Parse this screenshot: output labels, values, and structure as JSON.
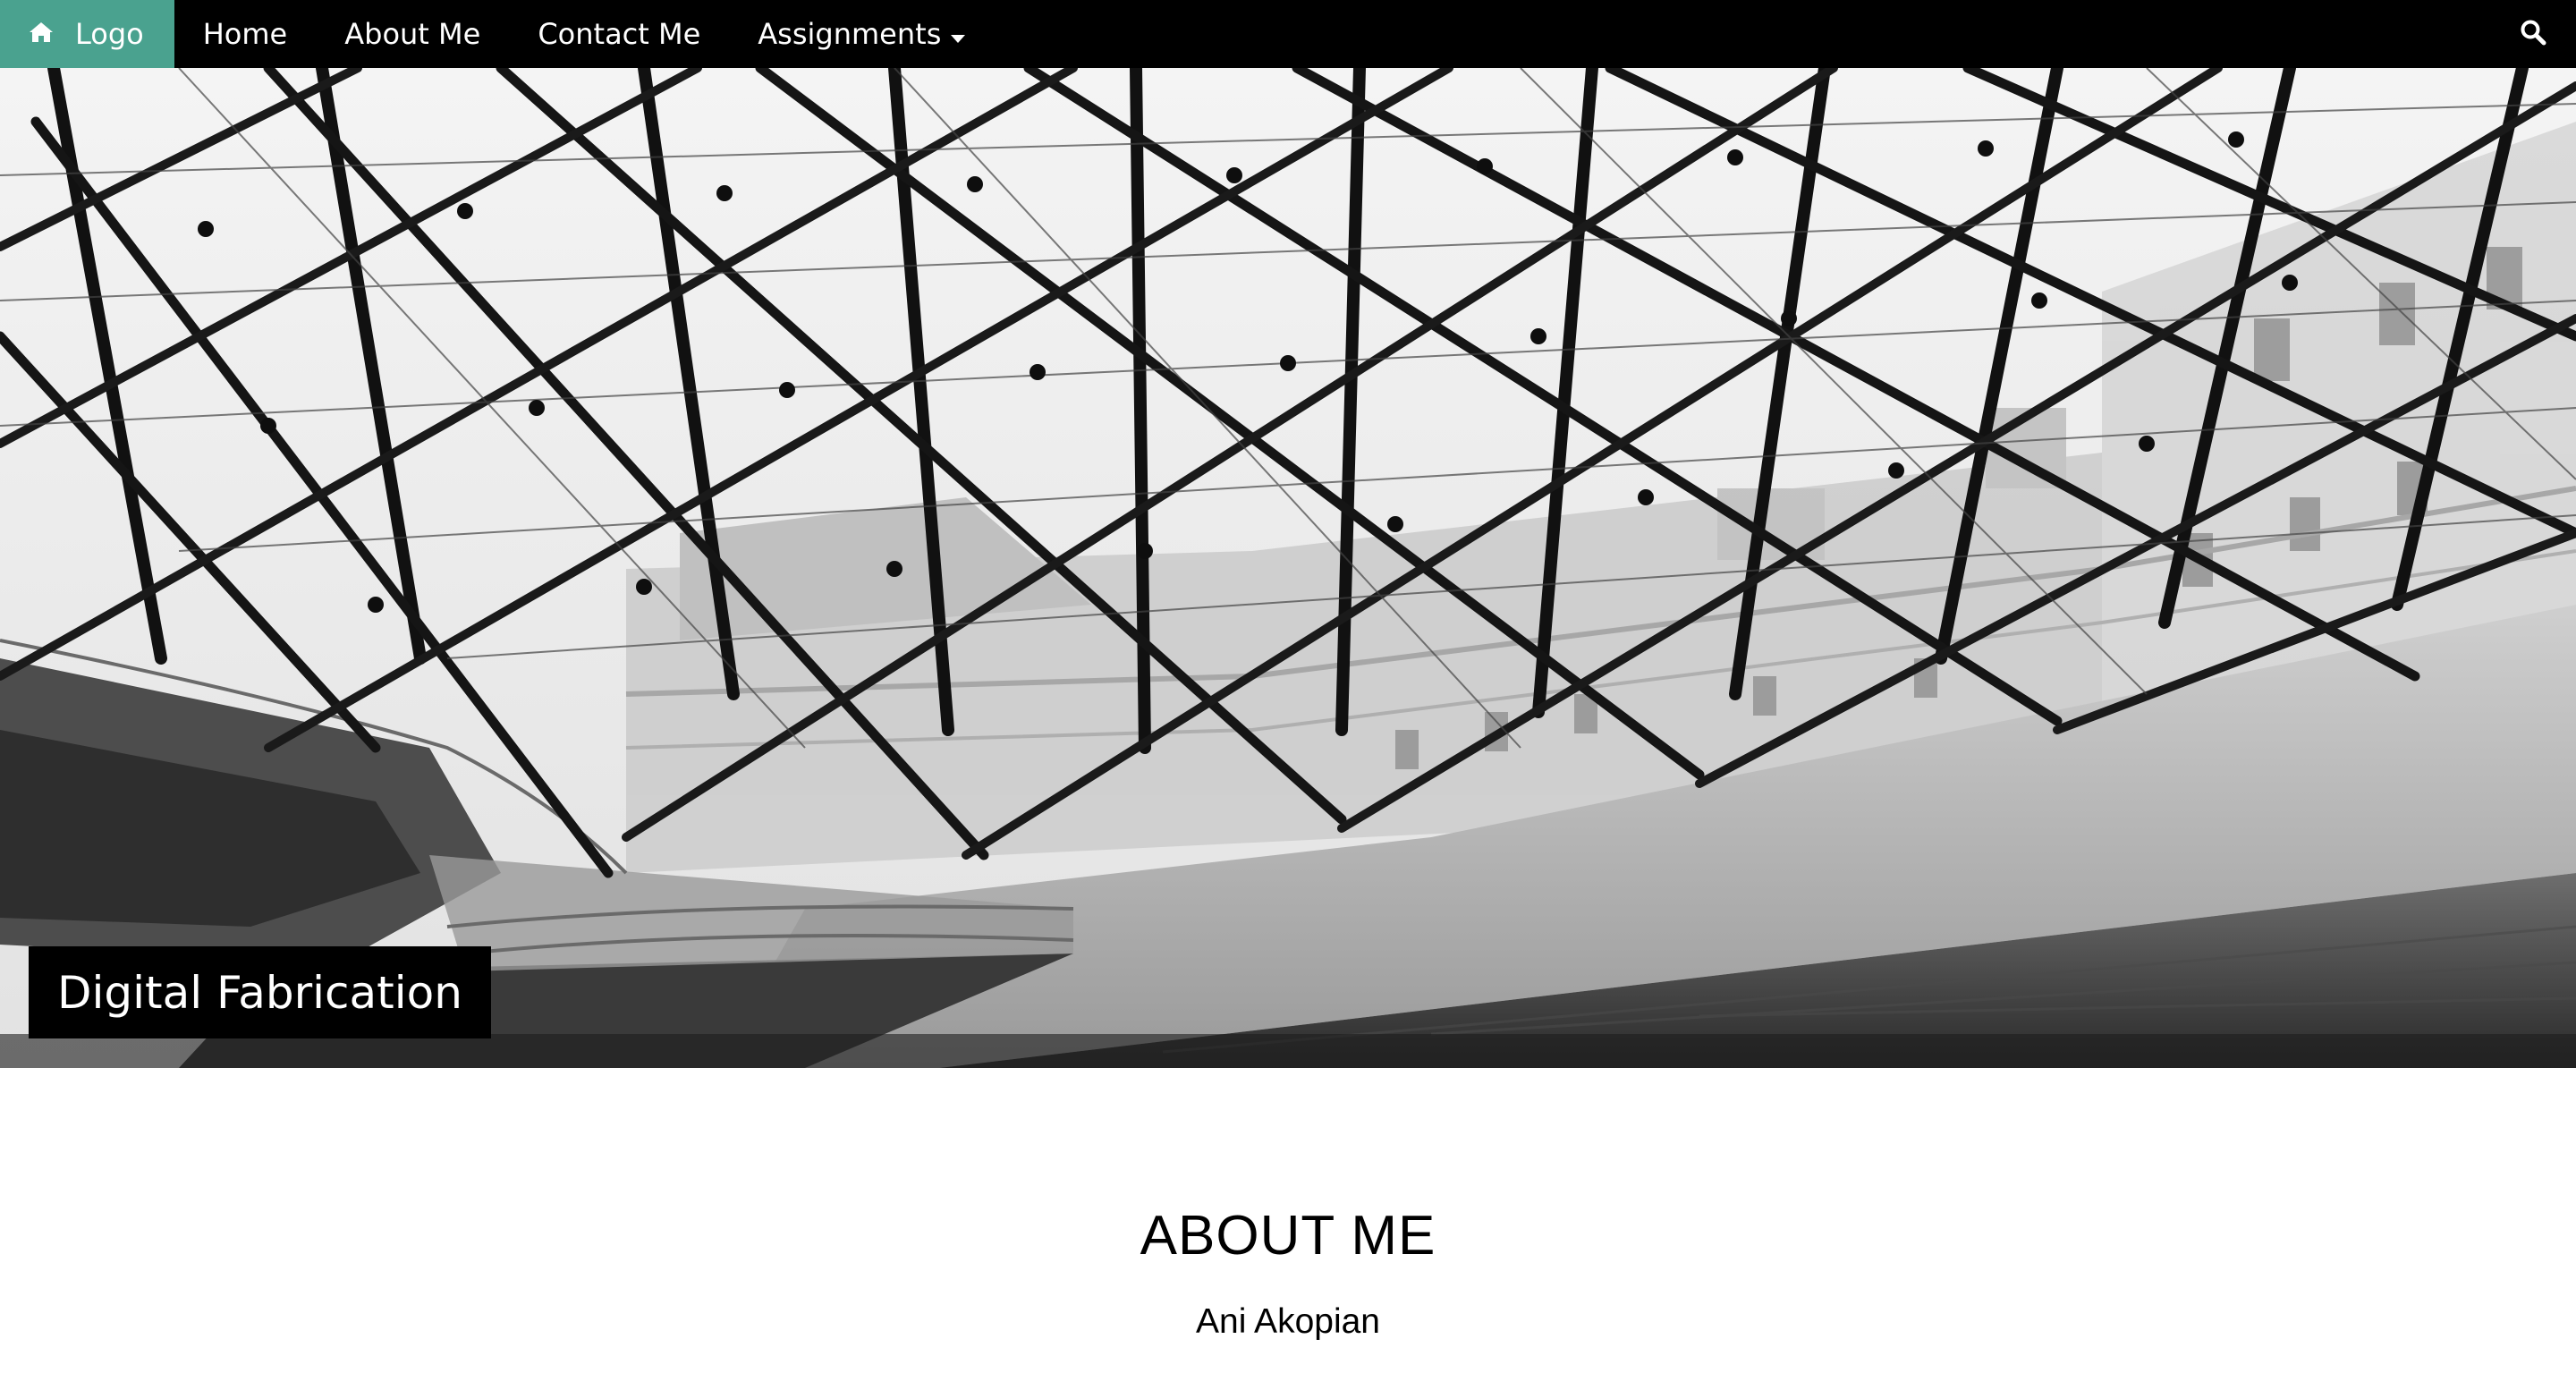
{
  "nav": {
    "logo_label": "Logo",
    "logo_icon": "home-icon",
    "items": [
      {
        "label": "Home"
      },
      {
        "label": "About Me"
      },
      {
        "label": "Contact Me"
      },
      {
        "label": "Assignments",
        "icon": "caret-down-icon"
      }
    ],
    "search_icon": "search-icon",
    "colors": {
      "bar": "#000000",
      "logo_bg": "#4aa28f",
      "text": "#ffffff"
    }
  },
  "hero": {
    "caption": "Digital Fabrication"
  },
  "about": {
    "title": "ABOUT ME",
    "subtitle": "Ani Akopian"
  }
}
